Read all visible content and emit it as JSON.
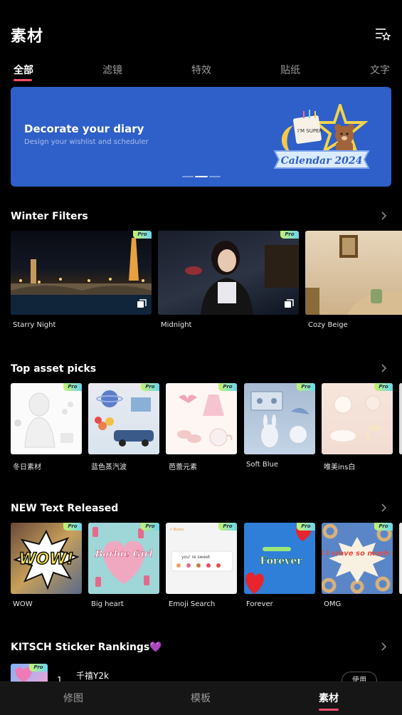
{
  "header": {
    "title": "素材",
    "menu_icon": "list-star-icon"
  },
  "tabs": [
    "全部",
    "滤镜",
    "特效",
    "贴纸",
    "文字"
  ],
  "banner": {
    "title": "Decorate your diary",
    "subtitle": "Design your wishlist and scheduler",
    "art_text": "Calendar 2024",
    "art_small": "I'M SUPER"
  },
  "sections": {
    "winter": {
      "title": "Winter Filters",
      "items": [
        "Starry Night",
        "Midnight",
        "Cozy Beige"
      ]
    },
    "assets": {
      "title": "Top asset picks",
      "items": [
        "冬日素材",
        "蓝色蒸汽波",
        "芭蕾元素",
        "Soft Blue",
        "唯美ins白"
      ]
    },
    "text": {
      "title": "NEW Text Released",
      "items": [
        "WOW",
        "Big heart",
        "Emoji Search",
        "Forever",
        "OMG"
      ]
    },
    "kitsch": {
      "title": "KITSCH Sticker Rankings💜"
    }
  },
  "text_art": {
    "wow": "WOW!",
    "barbie": "Barbie Girl",
    "emoji_input": "you' re sweet",
    "emoji_back": "< Notes",
    "forever": "Forever",
    "omg": "OMG I crave so much food"
  },
  "pro_label": "Pro",
  "ranking": {
    "number": "1",
    "name": "千禧Y2k",
    "button": "使用"
  },
  "bottom_nav": [
    "修图",
    "模板",
    "素材"
  ],
  "colors": {
    "accent": "#ff4d6d",
    "banner": "#2f5fc8",
    "background": "#000000",
    "pro_gradient_start": "#c6f36a",
    "pro_gradient_end": "#6ad6f3"
  }
}
